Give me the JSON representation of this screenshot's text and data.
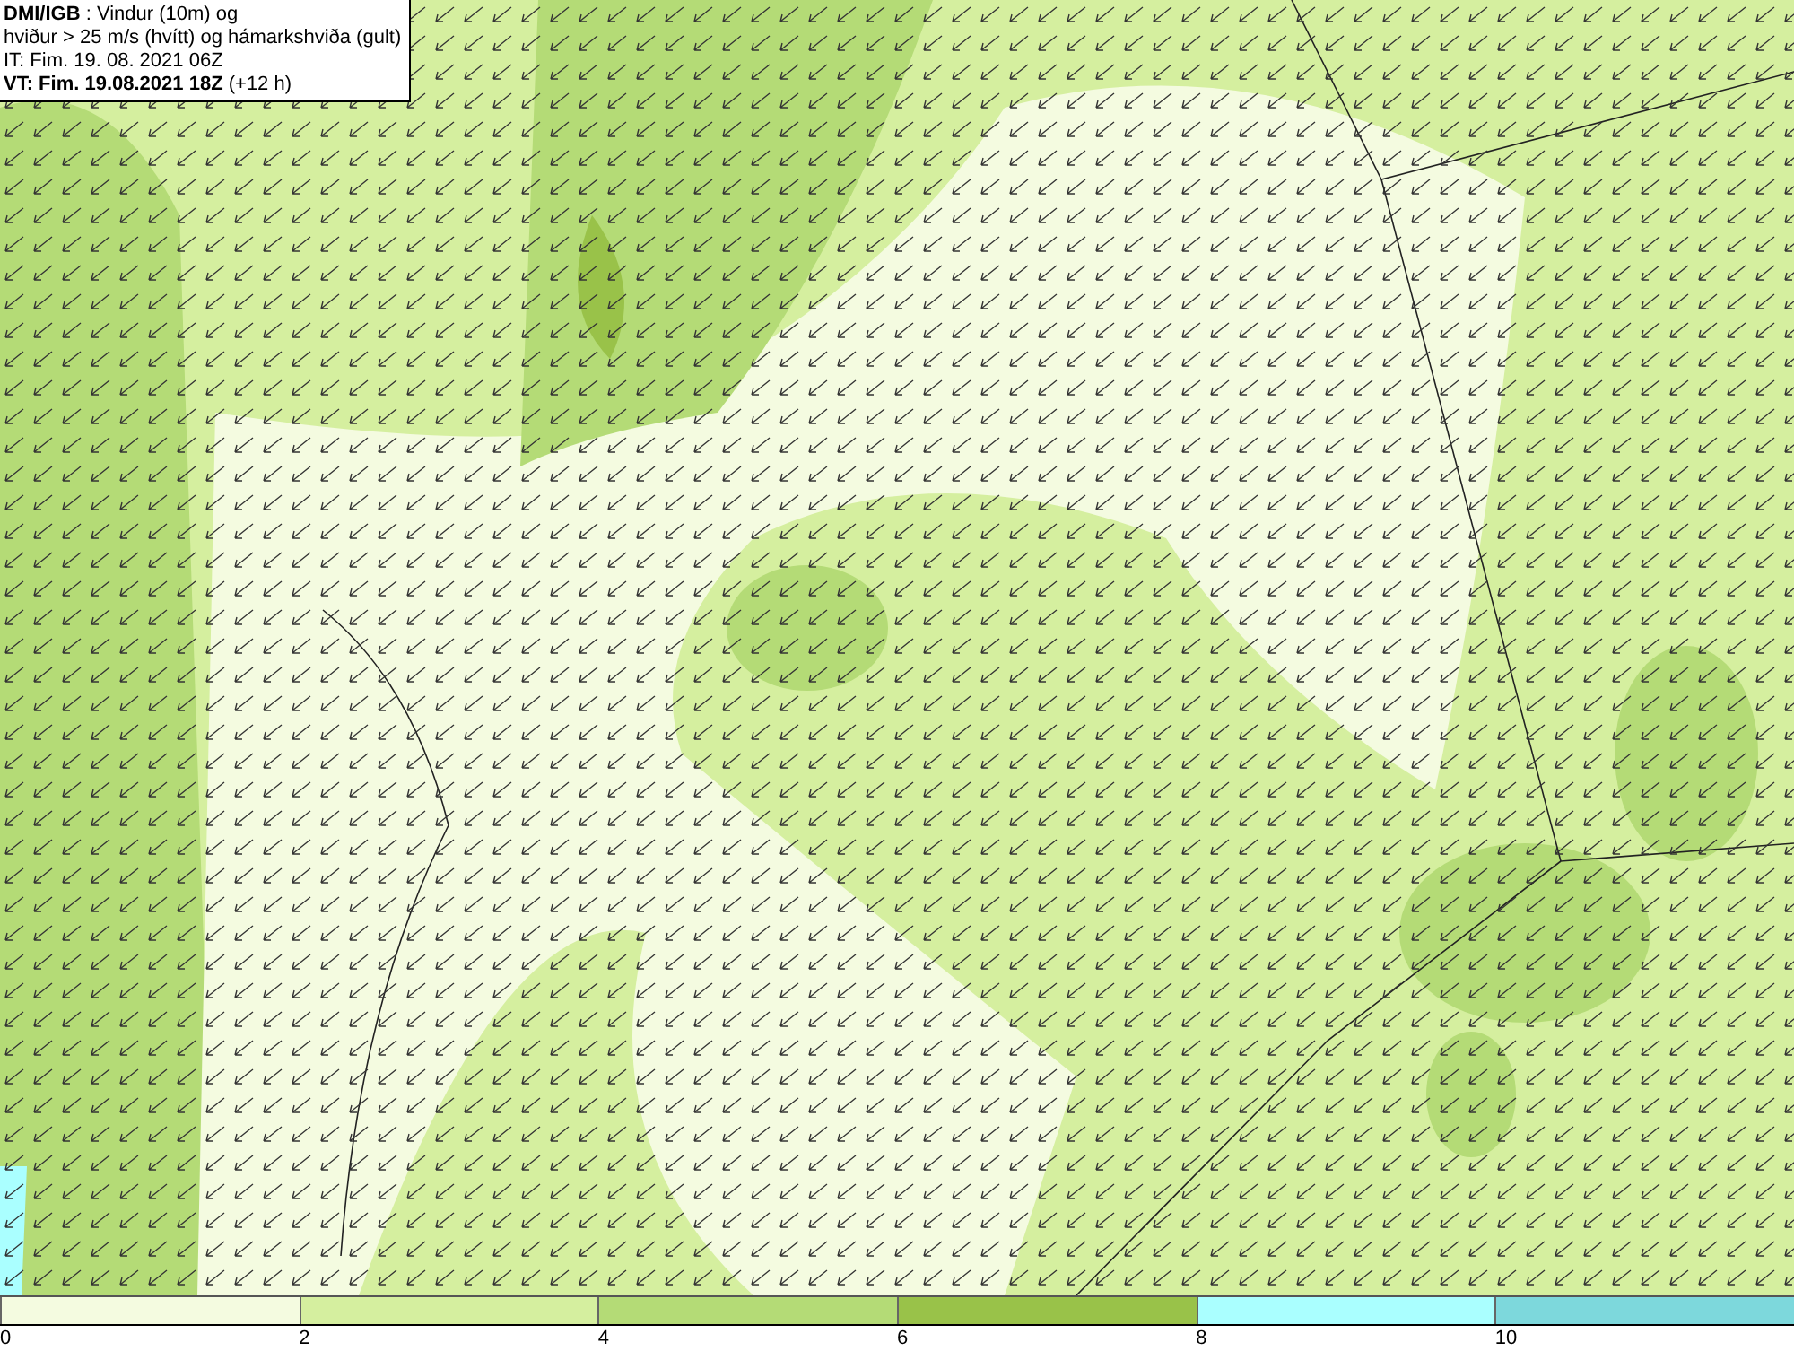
{
  "title_box": {
    "lines": [
      "**DMI/IGB** : Vindur (10m) og",
      "hviður > 25 m/s (hvítt) og hámarkshviða (gult)",
      "IT: Fim. 19. 08. 2021 06Z",
      "**VT: Fim. 19.08.2021 18Z** (+12 h)"
    ]
  },
  "legend": {
    "segments": [
      {
        "label": "0",
        "color": "#f4fbe0"
      },
      {
        "label": "2",
        "color": "#d5ef9f"
      },
      {
        "label": "4",
        "color": "#b4db76"
      },
      {
        "label": "6",
        "color": "#99c249"
      },
      {
        "label": "8",
        "color": "#aaffff"
      },
      {
        "label": "10",
        "color": "#7dd8dc"
      }
    ]
  }
}
